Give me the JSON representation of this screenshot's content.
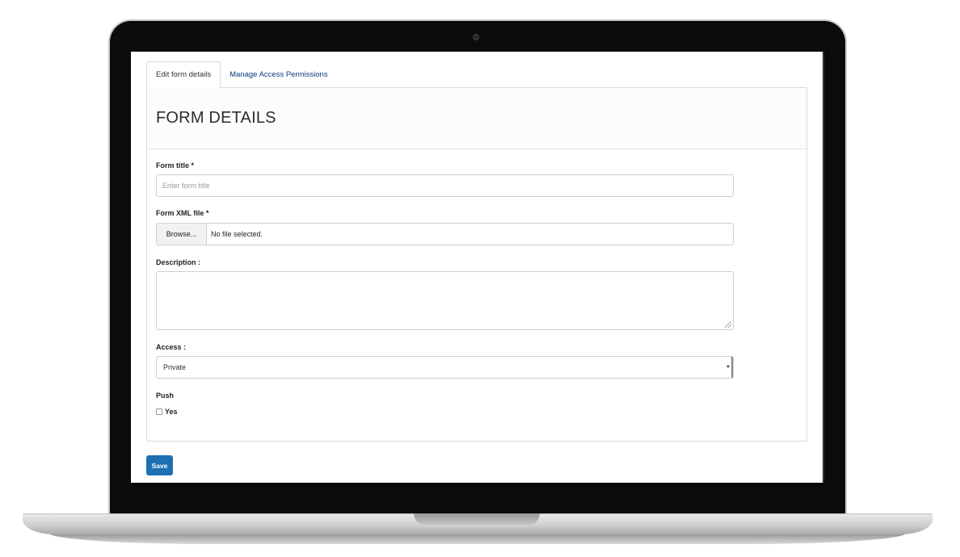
{
  "tabs": [
    {
      "label": "Edit form details",
      "active": true
    },
    {
      "label": "Manage Access Permissions",
      "active": false
    }
  ],
  "panel": {
    "title": "FORM DETAILS"
  },
  "fields": {
    "form_title": {
      "label": "Form title *",
      "placeholder": "Enter form title",
      "value": ""
    },
    "form_xml": {
      "label": "Form XML file *",
      "browse_label": "Browse...",
      "status": "No file selected."
    },
    "description": {
      "label": "Description :",
      "value": ""
    },
    "access": {
      "label": "Access :",
      "selected": "Private"
    },
    "push": {
      "label": "Push",
      "option_label": "Yes",
      "checked": false
    }
  },
  "actions": {
    "save_label": "Save"
  },
  "colors": {
    "primary_button": "#1e6fb3",
    "link": "#0d3a7a"
  }
}
